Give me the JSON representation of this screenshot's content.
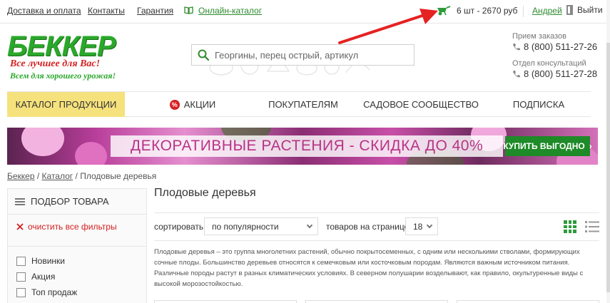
{
  "topbar": {
    "links": [
      {
        "label": "Доставка и оплата"
      },
      {
        "label": "Контакты"
      },
      {
        "label": "Гарантия"
      }
    ],
    "catalog_label": "Онлайн-каталог",
    "cart_text": "6 шт - 2670 руб",
    "user_name": "Андрей",
    "logout_label": "Выйти"
  },
  "logo": {
    "name": "БЕККЕР",
    "slogan1": "Все лучшее для Вас!",
    "slogan2": "Всем для хорошего урожая!"
  },
  "search": {
    "placeholder": "Георгины, перец острый, артикул"
  },
  "contacts": {
    "orders_label": "Прием заказов",
    "orders_phone": "8 (800) 511-27-26",
    "consult_label": "Отдел консультаций",
    "consult_phone": "8 (800) 511-27-28"
  },
  "nav": {
    "items": [
      {
        "label": "КАТАЛОГ ПРОДУКЦИИ"
      },
      {
        "label": "АКЦИИ"
      },
      {
        "label": "ПОКУПАТЕЛЯМ"
      },
      {
        "label": "САДОВОЕ СООБЩЕСТВО"
      },
      {
        "label": "ПОДПИСКА"
      }
    ],
    "promo_icon_text": "%"
  },
  "banner": {
    "text": "ДЕКОРАТИВНЫЕ РАСТЕНИЯ - СКИДКА ДО 40%",
    "button_label": "КУПИТЬ ВЫГОДНО",
    "button_arrow": "›"
  },
  "breadcrumb": {
    "items": [
      "Беккер",
      "Каталог",
      "Плодовые деревья"
    ],
    "separator": " / "
  },
  "sidebar": {
    "title": "ПОДБОР ТОВАРА",
    "clear_label": "очистить все фильтры",
    "filters": [
      {
        "label": "Новинки"
      },
      {
        "label": "Акция"
      },
      {
        "label": "Топ продаж"
      }
    ]
  },
  "main": {
    "title": "Плодовые деревья",
    "sort_label": "сортировать",
    "sort_value": "по популярности",
    "per_page_label": "товаров на странице",
    "per_page_value": "18",
    "description": "Плодовые деревья – это группа многолетних растений, обычно покрытосеменных, с одним или несколькими стволами, формирующих сочные плоды. Большинство деревьев относятся к семечковым или косточковым породам. Являются важным источником питания. Различные породы растут в разных климатических условиях. В северном полушарии возделывают, как правило, окультуренные виды с высокой морозостойкостью."
  },
  "colors": {
    "brand_green": "#2aa82a",
    "link_green": "#2e8b2e",
    "accent_yellow": "#f6e27c",
    "red": "#d62020",
    "banner_pink": "#b63486",
    "button_green": "#1e8a28"
  }
}
